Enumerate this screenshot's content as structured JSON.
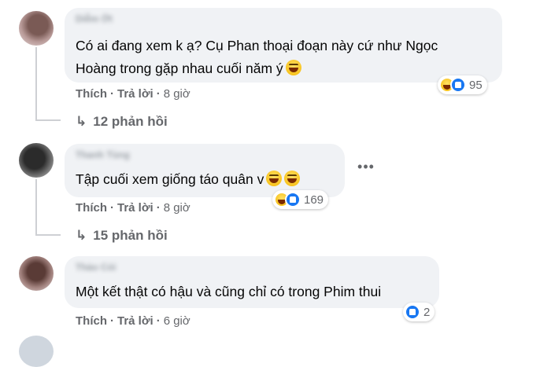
{
  "comments": [
    {
      "author": "Diễm Ớt",
      "lines": [
        "Có ai đang xem k ạ? Cụ Phan thoại đoạn này cứ như Ngọc",
        "Hoàng trong gặp nhau cuối năm ý"
      ],
      "emoji_icons": [
        "laughing-emoji"
      ],
      "reaction_icons": [
        "haha-reaction-icon",
        "like-reaction-icon"
      ],
      "reaction_count": "95",
      "like_label": "Thích",
      "reply_label": "Trả lời",
      "time": "8 giờ",
      "replies_label": "12 phản hồi"
    },
    {
      "author": "Thanh Tùng",
      "lines": [
        "Tập cuối xem giống táo quân v"
      ],
      "emoji_icons": [
        "laughing-emoji",
        "laughing-emoji"
      ],
      "reaction_icons": [
        "haha-reaction-icon",
        "like-reaction-icon"
      ],
      "reaction_count": "169",
      "like_label": "Thích",
      "reply_label": "Trả lời",
      "time": "8 giờ",
      "replies_label": "15 phản hồi",
      "more_icon": "more-options-icon"
    },
    {
      "author": "Thảo Cỏi",
      "lines": [
        "Một kết thật có hậu và cũng chỉ có trong Phim thui"
      ],
      "reaction_icons": [
        "like-reaction-icon"
      ],
      "reaction_count": "2",
      "like_label": "Thích",
      "reply_label": "Trả lời",
      "time": "6 giờ"
    }
  ],
  "reply_arrow_icon": "reply-arrow-icon",
  "separator": "·",
  "colors": {
    "bubble": "#f0f2f5",
    "meta_text": "#65676b",
    "like_blue": "#1877f2",
    "haha_yellow": "#f5b700"
  }
}
